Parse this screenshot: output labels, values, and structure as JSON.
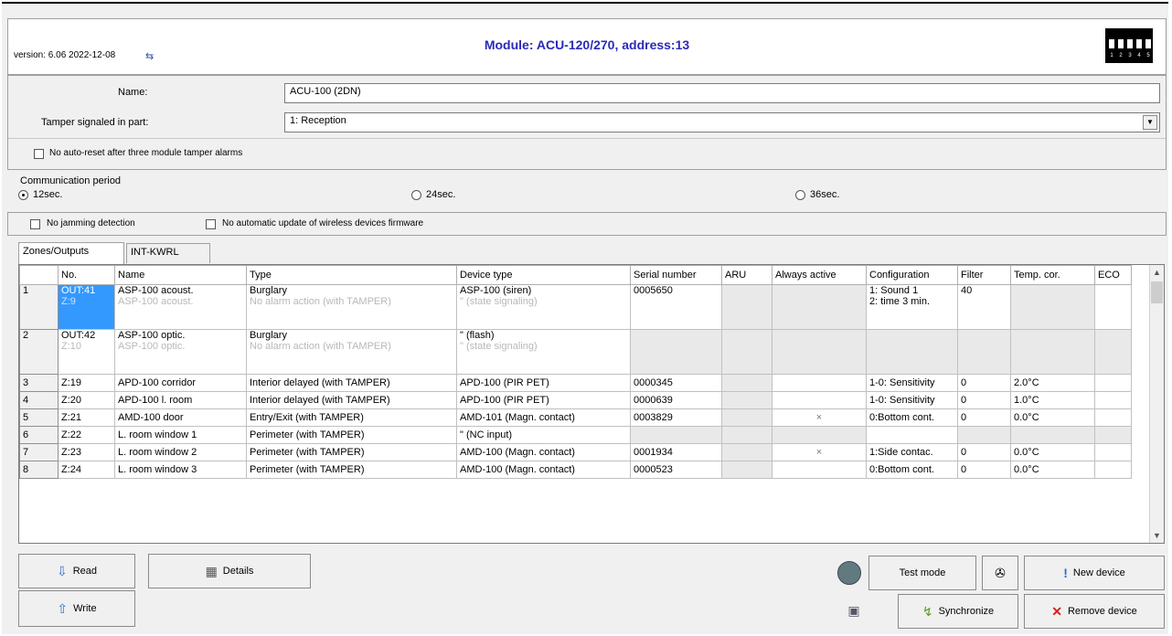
{
  "header": {
    "version": "version: 6.06 2022-12-08",
    "title": "Module: ACU-120/270, address:13",
    "dip_numbers": [
      "1",
      "2",
      "3",
      "4",
      "5"
    ]
  },
  "form": {
    "name_label": "Name:",
    "name_value": "ACU-100  (2DN)",
    "tamper_label": "Tamper signaled in part:",
    "tamper_value": "1: Reception",
    "no_autoreset_label": "No auto-reset after three module tamper alarms",
    "comm_period_label": "Communication period",
    "comm_options": [
      "12sec.",
      "24sec.",
      "36sec."
    ],
    "comm_selected": "12sec.",
    "no_jamming_label": "No jamming detection",
    "no_auto_update_label": "No automatic update of wireless devices firmware"
  },
  "tabs": [
    "Zones/Outputs",
    "INT-KWRL"
  ],
  "grid": {
    "columns": [
      "",
      "No.",
      "Name",
      "Type",
      "Device type",
      "Serial number",
      "ARU",
      "Always active",
      "Configuration",
      "Filter",
      "Temp. cor.",
      "ECO"
    ],
    "rows": [
      {
        "n": "1",
        "no": "OUT:41",
        "no2": "Z:9",
        "name": "ASP-100  acoust.",
        "name2": "ASP-100  acoust.",
        "type": "Burglary",
        "type2": "No alarm action (with TAMPER)",
        "dev": "ASP-100  (siren)",
        "dev2": "\"          (state signaling)",
        "serial": "0005650",
        "aru": "",
        "always": "",
        "config": "1: Sound 1",
        "config2": "2: time 3 min.",
        "filter": "40",
        "temp": "",
        "eco": ""
      },
      {
        "n": "2",
        "no": "OUT:42",
        "no2": "Z:10",
        "name": "ASP-100  optic.",
        "name2": "ASP-100  optic.",
        "type": "Burglary",
        "type2": "No alarm action (with TAMPER)",
        "dev": "\"                (flash)",
        "dev2": "\"          (state signaling)",
        "serial": "",
        "aru": "",
        "always": "",
        "config": "",
        "config2": "",
        "filter": "",
        "temp": "",
        "eco": ""
      },
      {
        "n": "3",
        "no": "Z:19",
        "name": "APD-100 corridor",
        "type": "Interior delayed (with TAMPER)",
        "dev": "APD-100  (PIR PET)",
        "serial": "0000345",
        "aru": "",
        "always": "",
        "config": "1-0: Sensitivity",
        "filter": "0",
        "temp": "2.0°C",
        "eco": ""
      },
      {
        "n": "4",
        "no": "Z:20",
        "name": "APD-100 l. room",
        "type": "Interior delayed (with TAMPER)",
        "dev": "APD-100  (PIR PET)",
        "serial": "0000639",
        "aru": "",
        "always": "",
        "config": "1-0: Sensitivity",
        "filter": "0",
        "temp": "1.0°C",
        "eco": ""
      },
      {
        "n": "5",
        "no": "Z:21",
        "name": "AMD-100 door",
        "type": "Entry/Exit (with TAMPER)",
        "dev": "AMD-101 (Magn. contact)",
        "serial": "0003829",
        "aru": "",
        "always": "×",
        "config": "0:Bottom cont.",
        "filter": "0",
        "temp": "0.0°C",
        "eco": ""
      },
      {
        "n": "6",
        "no": "Z:22",
        "name": "L. room window 1",
        "type": "Perimeter (with TAMPER)",
        "dev": "\"                (NC input)",
        "serial": "",
        "aru": "",
        "always": "",
        "config": "",
        "filter": "",
        "temp": "",
        "eco": ""
      },
      {
        "n": "7",
        "no": "Z:23",
        "name": "L. room window 2",
        "type": "Perimeter (with TAMPER)",
        "dev": "AMD-100 (Magn. contact)",
        "serial": "0001934",
        "aru": "",
        "always": "×",
        "config": "1:Side contac.",
        "filter": "0",
        "temp": "0.0°C",
        "eco": ""
      },
      {
        "n": "8",
        "no": "Z:24",
        "name": "L. room window 3",
        "type": "Perimeter (with TAMPER)",
        "dev": "AMD-100 (Magn. contact)",
        "serial": "0000523",
        "aru": "",
        "always": "",
        "config": "0:Bottom cont.",
        "filter": "0",
        "temp": "0.0°C",
        "eco": ""
      }
    ]
  },
  "buttons": {
    "read": "Read",
    "write": "Write",
    "details": "Details",
    "test_mode": "Test mode",
    "synchronize": "Synchronize",
    "new_device": "New device",
    "remove_device": "Remove device"
  },
  "colors": {
    "title": "#2a2ab8",
    "selection": "#3399ff"
  }
}
